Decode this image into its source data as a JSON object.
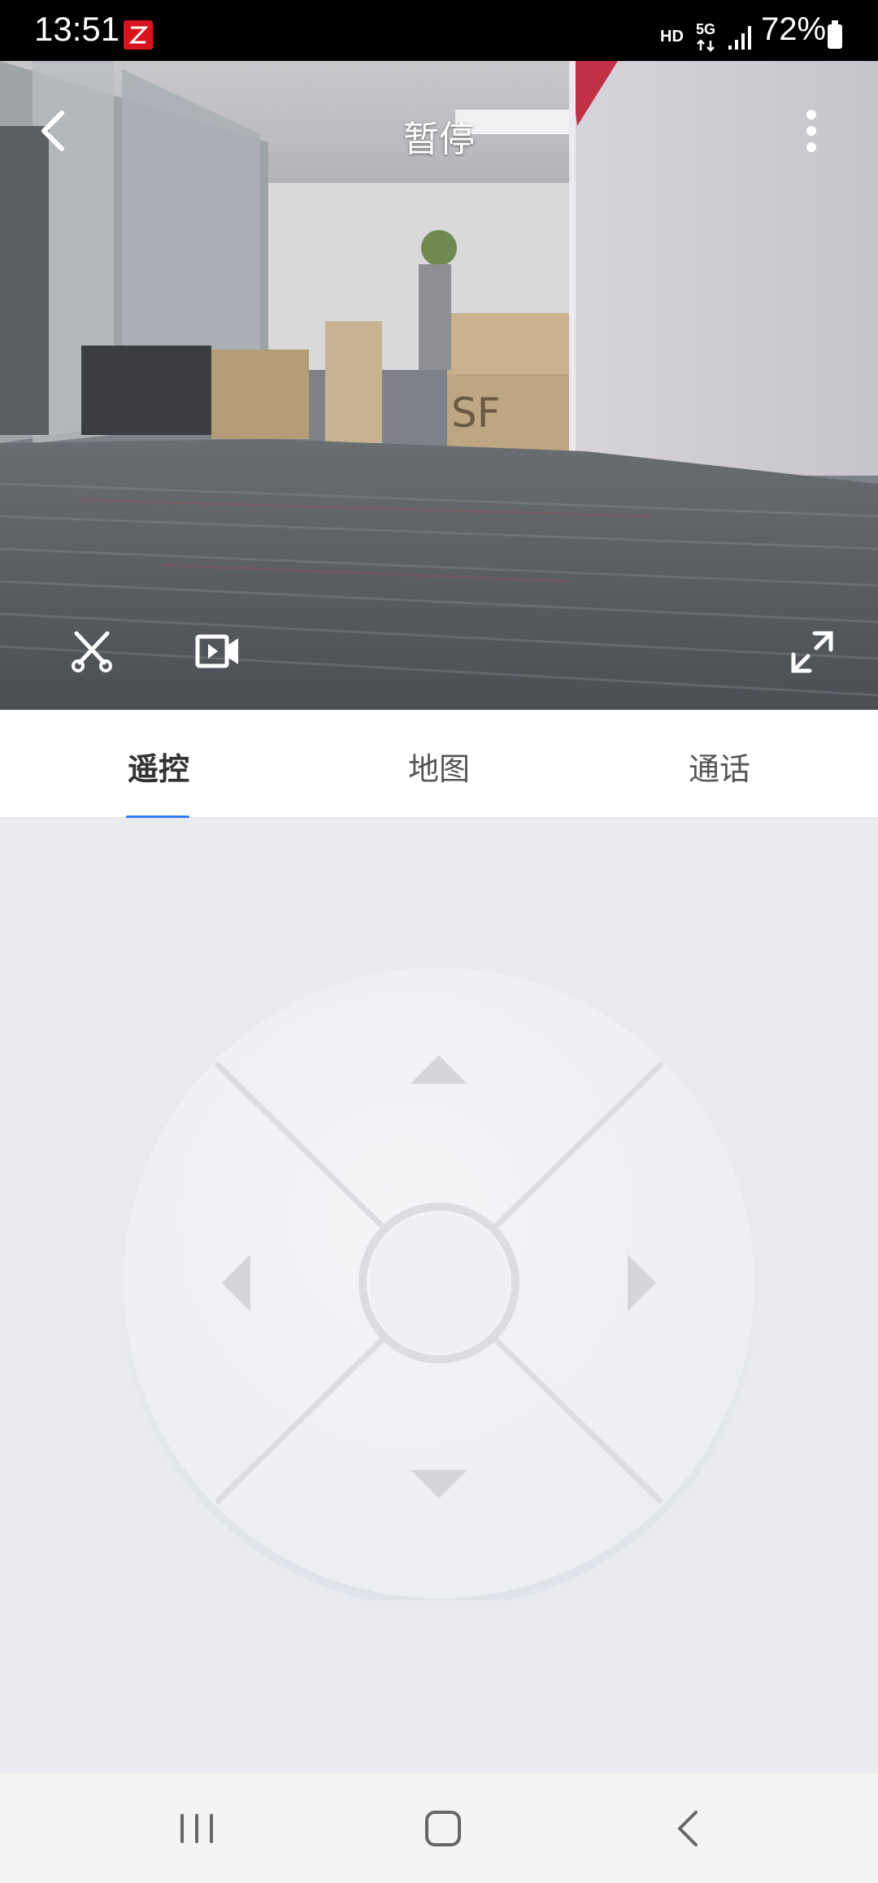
{
  "status_bar": {
    "time": "13:51",
    "network_hd": "HD",
    "network_5g": "5G",
    "battery": "72%"
  },
  "video": {
    "title": "暂停",
    "icons": [
      "back-arrow-icon",
      "more-vert-icon",
      "scissors-icon",
      "video-record-icon",
      "fullscreen-icon"
    ]
  },
  "tabs": [
    {
      "label": "遥控",
      "active": true
    },
    {
      "label": "地图",
      "active": false
    },
    {
      "label": "通话",
      "active": false
    }
  ],
  "colors": {
    "accent": "#2f7bf5",
    "page_bg": "#e9ebf0"
  },
  "nav_icons": [
    "recent-apps-icon",
    "home-icon",
    "back-icon"
  ]
}
